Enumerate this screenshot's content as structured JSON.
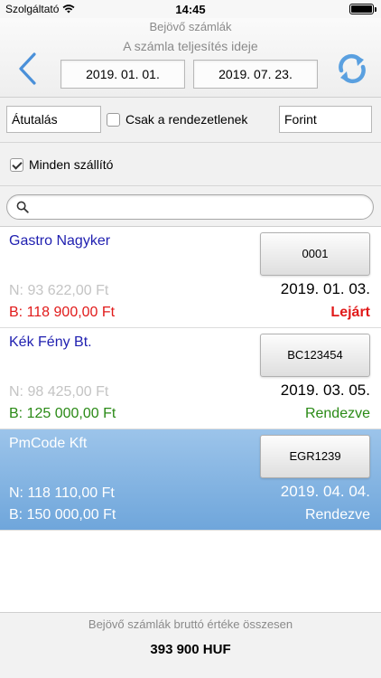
{
  "status_bar": {
    "carrier": "Szolgáltató",
    "time": "14:45",
    "battery_level": 1.0
  },
  "header": {
    "title": "Bejövő számlák",
    "subtitle": "A számla teljesítés ideje",
    "date_from": "2019. 01. 01.",
    "date_to": "2019. 07. 23."
  },
  "filters": {
    "payment_method": "Átutalás",
    "only_unsettled_label": "Csak a rendezetlenek",
    "only_unsettled_checked": false,
    "currency": "Forint",
    "all_suppliers_label": "Minden szállító",
    "all_suppliers_checked": true
  },
  "search": {
    "value": ""
  },
  "invoices": [
    {
      "supplier": "Gastro Nagyker",
      "id": "0001",
      "net": "N: 93 622,00 Ft",
      "date": "2019. 01. 03.",
      "gross": "B: 118 900,00 Ft",
      "status": "Lejárt",
      "status_color": "#e11a1a",
      "selected": false
    },
    {
      "supplier": "Kék Fény Bt.",
      "id": "BC123454",
      "net": "N: 98 425,00 Ft",
      "date": "2019. 03. 05.",
      "gross": "B: 125 000,00 Ft",
      "status": "Rendezve",
      "status_color": "#2a8a16",
      "selected": false
    },
    {
      "supplier": "PmCode Kft",
      "id": "EGR1239",
      "net": "N: 118 110,00 Ft",
      "date": "2019. 04. 04.",
      "gross": "B: 150 000,00 Ft",
      "status": "Rendezve",
      "status_color": "#ffffff",
      "selected": true
    }
  ],
  "footer": {
    "label": "Bejövő számlák bruttó értéke összesen",
    "total": "393 900 HUF"
  },
  "colors": {
    "accent_blue": "#4a90d9",
    "selected_row": "#7fb0e0",
    "supplier_link": "#1f1fb0",
    "overdue_red": "#e11a1a",
    "settled_green": "#2a8a16"
  }
}
